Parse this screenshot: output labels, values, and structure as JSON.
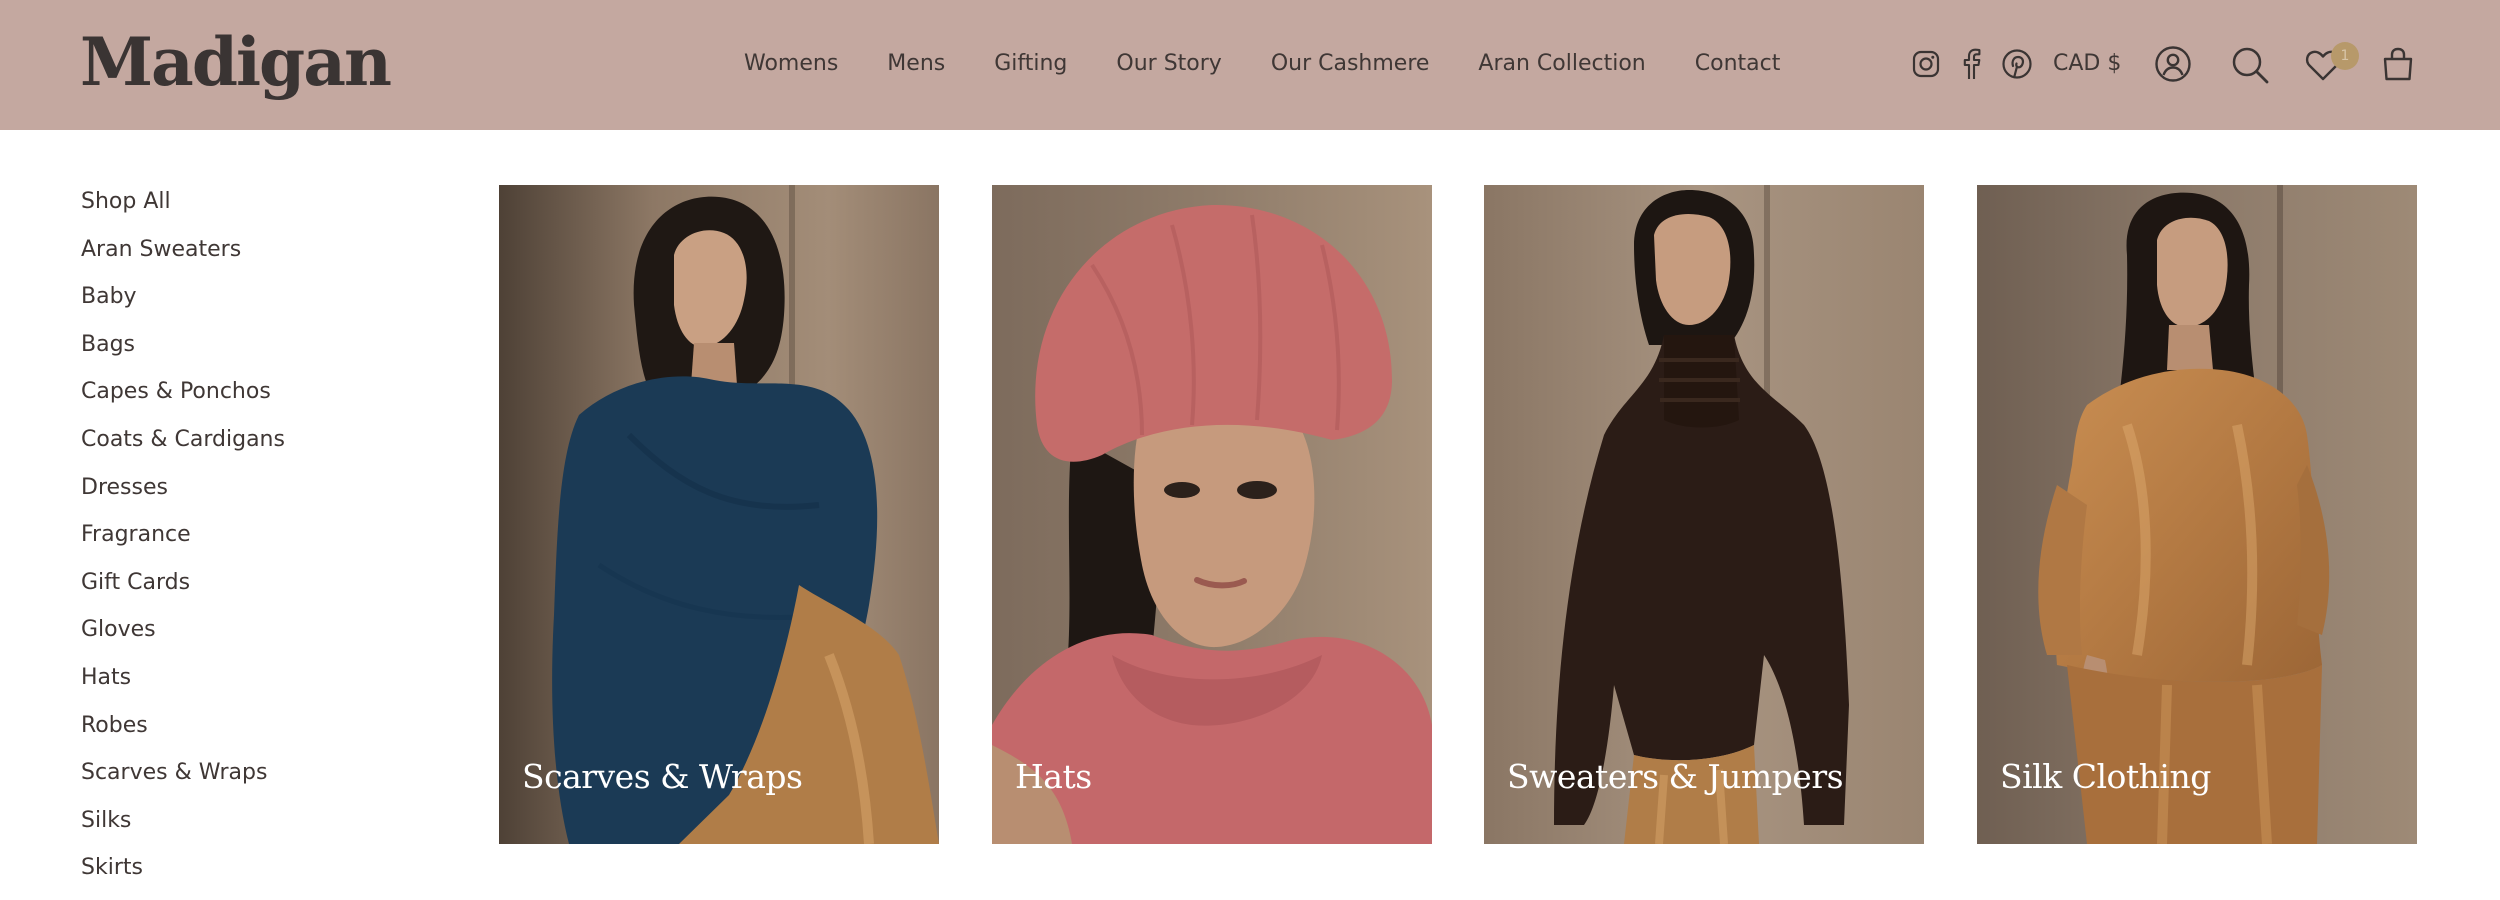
{
  "brand": {
    "logo": "Madigan"
  },
  "nav": {
    "items": [
      "Womens",
      "Mens",
      "Gifting",
      "Our Story",
      "Our Cashmere",
      "Aran Collection",
      "Contact"
    ]
  },
  "utility": {
    "currency": "CAD $",
    "wishlist_count": "1",
    "icons": [
      "instagram-icon",
      "facebook-icon",
      "pinterest-icon",
      "account-icon",
      "search-icon",
      "heart-icon",
      "bag-icon"
    ]
  },
  "sidebar": {
    "items": [
      "Shop All",
      "Aran Sweaters",
      "Baby",
      "Bags",
      "Capes & Ponchos",
      "Coats & Cardigans",
      "Dresses",
      "Fragrance",
      "Gift Cards",
      "Gloves",
      "Hats",
      "Robes",
      "Scarves & Wraps",
      "Silks",
      "Skirts"
    ]
  },
  "tiles": [
    {
      "label": "Scarves & Wraps"
    },
    {
      "label": "Hats"
    },
    {
      "label": "Sweaters & Jumpers"
    },
    {
      "label": "Silk Clothing"
    }
  ],
  "colors": {
    "header_bg": "#c4a8a0",
    "text": "#3a3433",
    "badge": "#b7996a"
  }
}
